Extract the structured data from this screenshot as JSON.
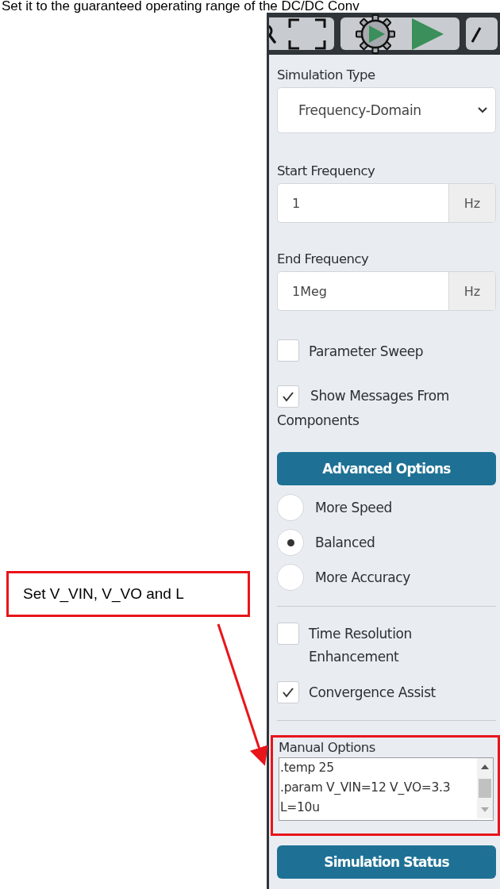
{
  "intro_text": "Set it to the guaranteed operating range of the DC/DC Conv",
  "callout": {
    "text": "Set V_VIN, V_VO and L"
  },
  "simulation_type": {
    "label": "Simulation Type",
    "value": "Frequency-Domain"
  },
  "frequency_fields": [
    {
      "label": "Start Frequency",
      "value": "1",
      "unit": "Hz"
    },
    {
      "label": "End Frequency",
      "value": "1Meg",
      "unit": "Hz"
    }
  ],
  "options": [
    {
      "label": "Parameter Sweep",
      "checked": false
    },
    {
      "label": "Show Messages From Components",
      "checked": true
    }
  ],
  "advanced_options_button": "Advanced Options",
  "accuracy_modes": [
    {
      "label": "More Speed",
      "selected": false
    },
    {
      "label": "Balanced",
      "selected": true
    },
    {
      "label": "More Accuracy",
      "selected": false
    }
  ],
  "solver_options": [
    {
      "label": "Time Resolution Enhancement",
      "checked": false
    },
    {
      "label": "Convergence Assist",
      "checked": true
    }
  ],
  "manual_options": {
    "label": "Manual Options",
    "lines": [
      ".temp 25",
      ".param V_VIN=12 V_VO=3.3",
      "L=10u"
    ]
  },
  "simulation_status_button": "Simulation Status"
}
